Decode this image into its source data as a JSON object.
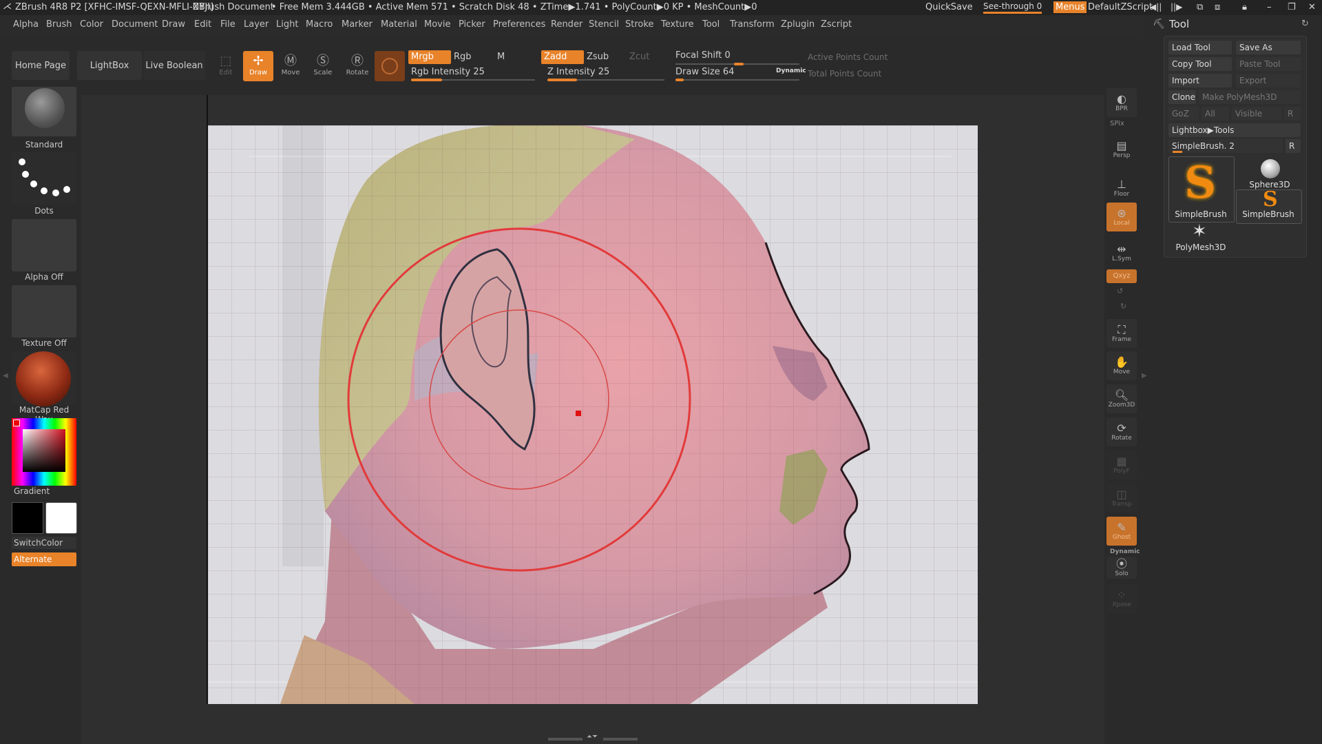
{
  "titlebar": {
    "app": "ZBrush 4R8 P2 [XFHC-IMSF-QEXN-MFLI-NYJI]",
    "document": "ZBrush Document",
    "stats": "• Free Mem 3.444GB • Active Mem 571 • Scratch Disk 48 • ZTime▶1.741 • PolyCount▶0 KP • MeshCount▶0",
    "quicksave": "QuickSave",
    "see_through": "See-through  0",
    "menus": "Menus",
    "default_script": "DefaultZScript"
  },
  "menubar": {
    "items": [
      "Alpha",
      "Brush",
      "Color",
      "Document",
      "Draw",
      "Edit",
      "File",
      "Layer",
      "Light",
      "Macro",
      "Marker",
      "Material",
      "Movie",
      "Picker",
      "Preferences",
      "Render",
      "Stencil",
      "Stroke",
      "Texture",
      "Tool",
      "Transform",
      "Zplugin",
      "Zscript"
    ]
  },
  "shelf": {
    "home_page": "Home Page",
    "lightbox": "LightBox",
    "live_boolean": "Live Boolean",
    "edit": "Edit",
    "draw": "Draw",
    "move": "Move",
    "scale": "Scale",
    "rotate": "Rotate",
    "mrgb": "Mrgb",
    "rgb": "Rgb",
    "m": "M",
    "zadd": "Zadd",
    "zsub": "Zsub",
    "zcut": "Zcut",
    "rgb_intensity": "Rgb Intensity 25",
    "z_intensity": "Z Intensity 25",
    "focal_shift": "Focal Shift 0",
    "draw_size": "Draw Size 64",
    "dynamic": "Dynamic",
    "active_points": "Active Points Count",
    "total_points": "Total Points Count",
    "rgb_intensity_value": 25,
    "z_intensity_value": 25,
    "draw_size_value": 64
  },
  "lefttray": {
    "brush": "Standard",
    "stroke": "Dots",
    "alpha": "Alpha Off",
    "texture": "Texture Off",
    "material": "MatCap Red Wax",
    "gradient": "Gradient",
    "switchcolor": "SwitchColor",
    "alternate": "Alternate"
  },
  "rightnav": {
    "bpr": "BPR",
    "spix": "SPix",
    "persp": "Persp",
    "floor": "Floor",
    "local": "Local",
    "lsym": "L.Sym",
    "xyz": "Qxyz",
    "frame": "Frame",
    "move": "Move",
    "zoom3d": "Zoom3D",
    "rotate": "Rotate",
    "polyf": "PolyF",
    "transp": "Transp",
    "ghost": "Ghost",
    "dynamic": "Dynamic",
    "solo": "Solo",
    "xpose": "Xpose"
  },
  "toolpanel": {
    "title": "Tool",
    "load_tool": "Load Tool",
    "save_as": "Save As",
    "copy_tool": "Copy Tool",
    "paste_tool": "Paste Tool",
    "import": "Import",
    "export": "Export",
    "clone": "Clone",
    "make_polymesh": "Make PolyMesh3D",
    "goz": "GoZ",
    "all": "All",
    "visible": "Visible",
    "r": "R",
    "lightbox_tools": "Lightbox▶Tools",
    "current_tool": "SimpleBrush. 2",
    "thumb1": "SimpleBrush",
    "thumb2": "Sphere3D",
    "thumb3": "SimpleBrush",
    "thumb4": "PolyMesh3D"
  },
  "colors": {
    "accent": "#e8832a",
    "background": "#2a2a2a"
  }
}
